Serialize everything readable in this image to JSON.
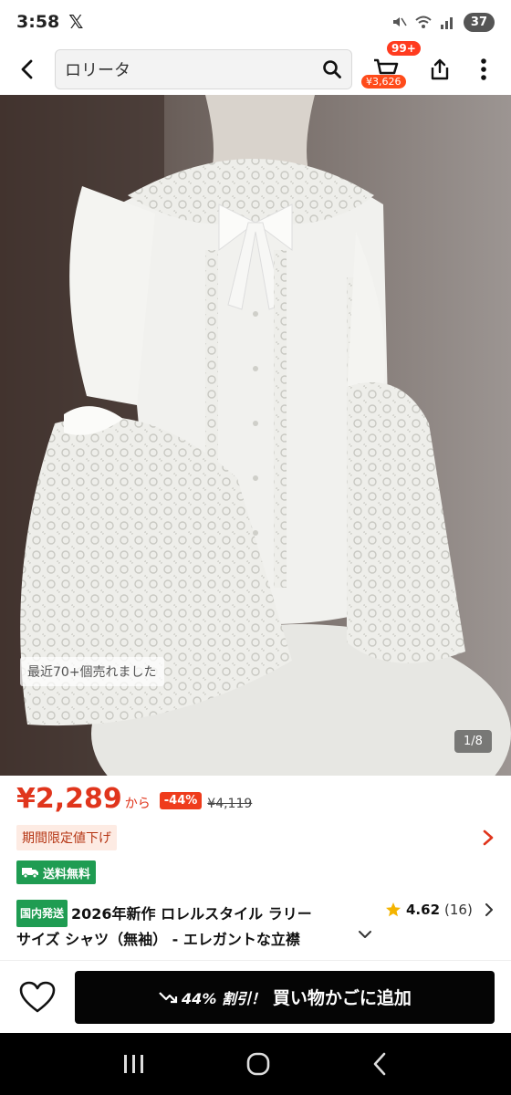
{
  "status_bar": {
    "time": "3:58",
    "app_icon": "x-logo",
    "battery": "37",
    "icons": [
      "mute-icon",
      "wifi-icon",
      "signal-icon"
    ]
  },
  "header": {
    "search_value": "ロリータ",
    "cart_count": "99+",
    "cart_amount": "¥3,626",
    "icons": [
      "back-arrow-icon",
      "search-icon",
      "cart-icon",
      "share-icon",
      "more-icon"
    ]
  },
  "hero": {
    "sold_text": "最近70+個売れました",
    "page_indicator": "1/8"
  },
  "price": {
    "amount": "¥2,289",
    "suffix": "から",
    "discount": "-44%",
    "original": "¥4,119"
  },
  "limited": {
    "label": "期間限定値下げ"
  },
  "shipping": {
    "label": "送料無料"
  },
  "product": {
    "domestic_tag": "国内発送",
    "title_line1": "2026年新作 ロレルスタイル ラリー",
    "title_line2": "サイズ シャツ（無袖） - エレガントな立襟"
  },
  "rating": {
    "value": "4.62",
    "count": "(16)"
  },
  "bottom_bar": {
    "discount_text": "44% 割引！",
    "button_label": "買い物かごに追加"
  },
  "colors": {
    "accent_red": "#e0351c",
    "green": "#1f9c52",
    "button_black": "#050505"
  }
}
